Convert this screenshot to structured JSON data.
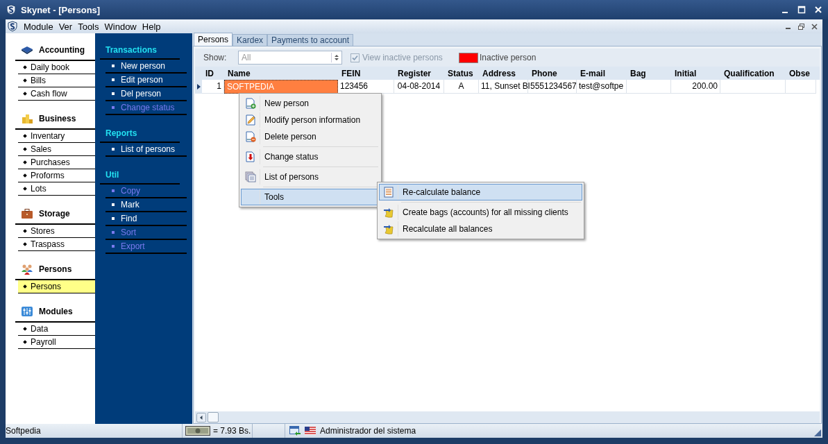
{
  "window": {
    "title": "Skynet - [Persons]"
  },
  "menu": [
    "Module",
    "Ver",
    "Tools",
    "Window",
    "Help"
  ],
  "sidebar": {
    "groups": [
      {
        "title": "Accounting",
        "items": [
          {
            "label": "Daily book",
            "selected": false
          },
          {
            "label": "Bills",
            "selected": false
          },
          {
            "label": "Cash flow",
            "selected": false
          }
        ]
      },
      {
        "title": "Business",
        "items": [
          {
            "label": "Inventary",
            "selected": false
          },
          {
            "label": "Sales",
            "selected": false
          },
          {
            "label": "Purchases",
            "selected": false
          },
          {
            "label": "Proforms",
            "selected": false
          },
          {
            "label": "Lots",
            "selected": false
          }
        ]
      },
      {
        "title": "Storage",
        "items": [
          {
            "label": "Stores",
            "selected": false
          },
          {
            "label": "Traspass",
            "selected": false
          }
        ]
      },
      {
        "title": "Persons",
        "items": [
          {
            "label": "Persons",
            "selected": true
          }
        ]
      },
      {
        "title": "Modules",
        "items": [
          {
            "label": "Data",
            "selected": false
          },
          {
            "label": "Payroll",
            "selected": false
          }
        ]
      }
    ]
  },
  "tasks": [
    {
      "title": "Transactions",
      "items": [
        {
          "label": "New person",
          "disabled": false
        },
        {
          "label": "Edit person",
          "disabled": false
        },
        {
          "label": "Del person",
          "disabled": false
        },
        {
          "label": "Change status",
          "disabled": true
        }
      ]
    },
    {
      "title": "Reports",
      "items": [
        {
          "label": "List of persons",
          "disabled": false
        }
      ]
    },
    {
      "title": "Util",
      "items": [
        {
          "label": "Copy",
          "disabled": true
        },
        {
          "label": "Mark",
          "disabled": false
        },
        {
          "label": "Find",
          "disabled": false
        },
        {
          "label": "Sort",
          "disabled": true
        },
        {
          "label": "Export",
          "disabled": true
        }
      ]
    }
  ],
  "tabs": [
    {
      "label": "Persons",
      "selected": true
    },
    {
      "label": "Kardex",
      "selected": false
    },
    {
      "label": "Payments to account",
      "selected": false
    }
  ],
  "filter": {
    "show_label": "Show:",
    "show_value": "All",
    "view_inactive": {
      "label": "View inactive persons",
      "checked": true,
      "disabled": true
    },
    "legend": "Inactive person"
  },
  "table": {
    "columns": [
      "ID",
      "Name",
      "FEIN",
      "Register",
      "Status",
      "Address",
      "Phone",
      "E-mail",
      "Bag",
      "Initial",
      "Qualification",
      "Obse"
    ],
    "rows": [
      {
        "selected": true,
        "cells": [
          "1",
          "SOFTPEDIA",
          "123456",
          "04-08-2014",
          "A",
          "11, Sunset Bl",
          "5551234567",
          "test@softpe",
          "",
          "200.00",
          "",
          ""
        ]
      }
    ]
  },
  "context_menu": [
    {
      "label": "New person",
      "separator_before": false,
      "selected": false
    },
    {
      "label": "Modify person information",
      "separator_before": false,
      "selected": false
    },
    {
      "label": "Delete person",
      "separator_before": false,
      "selected": false
    },
    {
      "label": "Change status",
      "separator_before": true,
      "selected": false
    },
    {
      "label": "List of persons",
      "separator_before": true,
      "selected": false
    },
    {
      "label": "Tools",
      "separator_before": true,
      "selected": true,
      "children": [
        {
          "label": "Re-calculate balance",
          "separator_before": false,
          "selected": true
        },
        {
          "label": "Create bags (accounts) for all missing clients",
          "separator_before": true,
          "selected": false
        },
        {
          "label": "Recalculate all balances",
          "separator_before": false,
          "selected": false
        }
      ]
    }
  ],
  "status_bar": {
    "text": "Softpedia",
    "rate": "= 7.93 Bs.",
    "user": "Administrador del sistema"
  }
}
